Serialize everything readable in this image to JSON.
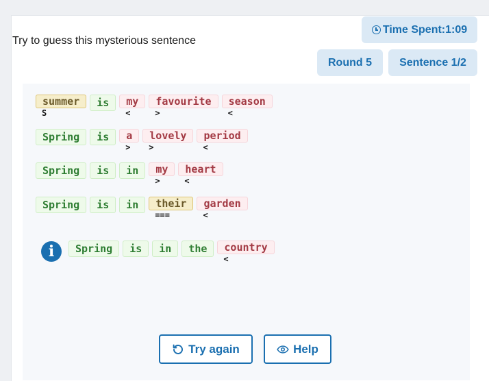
{
  "header": {
    "prompt": "Try to guess this mysterious sentence",
    "time_label": "Time Spent:1:09",
    "round_label": "Round 5",
    "sentence_label": "Sentence 1/2"
  },
  "guesses": [
    {
      "words": [
        {
          "text": "summer",
          "status": "yellow",
          "hint": "S"
        },
        {
          "text": "is",
          "status": "green",
          "hint": ""
        },
        {
          "text": "my",
          "status": "red",
          "hint": "<"
        },
        {
          "text": "favourite",
          "status": "red",
          "hint": ">"
        },
        {
          "text": "season",
          "status": "red",
          "hint": "<"
        }
      ]
    },
    {
      "words": [
        {
          "text": "Spring",
          "status": "green",
          "hint": ""
        },
        {
          "text": "is",
          "status": "green",
          "hint": ""
        },
        {
          "text": "a",
          "status": "red",
          "hint": ">"
        },
        {
          "text": "lovely",
          "status": "red",
          "hint": ">"
        },
        {
          "text": "period",
          "status": "red",
          "hint": "<"
        }
      ]
    },
    {
      "words": [
        {
          "text": "Spring",
          "status": "green",
          "hint": ""
        },
        {
          "text": "is",
          "status": "green",
          "hint": ""
        },
        {
          "text": "in",
          "status": "green",
          "hint": ""
        },
        {
          "text": "my",
          "status": "red",
          "hint": ">"
        },
        {
          "text": "heart",
          "status": "red",
          "hint": "<"
        }
      ]
    },
    {
      "words": [
        {
          "text": "Spring",
          "status": "green",
          "hint": ""
        },
        {
          "text": "is",
          "status": "green",
          "hint": ""
        },
        {
          "text": "in",
          "status": "green",
          "hint": ""
        },
        {
          "text": "their",
          "status": "yellow",
          "hint": "==="
        },
        {
          "text": "garden",
          "status": "red",
          "hint": "<"
        }
      ]
    },
    {
      "words": [
        {
          "text": "Spring",
          "status": "green",
          "hint": ""
        },
        {
          "text": "is",
          "status": "green",
          "hint": ""
        },
        {
          "text": "in",
          "status": "green",
          "hint": ""
        },
        {
          "text": "the",
          "status": "green",
          "hint": ""
        },
        {
          "text": "country",
          "status": "red",
          "hint": "<"
        }
      ]
    }
  ],
  "actions": {
    "try_again_label": "Try again",
    "help_label": "Help"
  },
  "icons": {
    "time": "clock-icon",
    "info": "info-icon",
    "try_again": "rotate-left-icon",
    "help": "eye-icon"
  },
  "colors": {
    "accent": "#1a6fb0",
    "correct": "#2e7d32",
    "wrong": "#a33a44",
    "misplaced": "#f6eecb"
  }
}
